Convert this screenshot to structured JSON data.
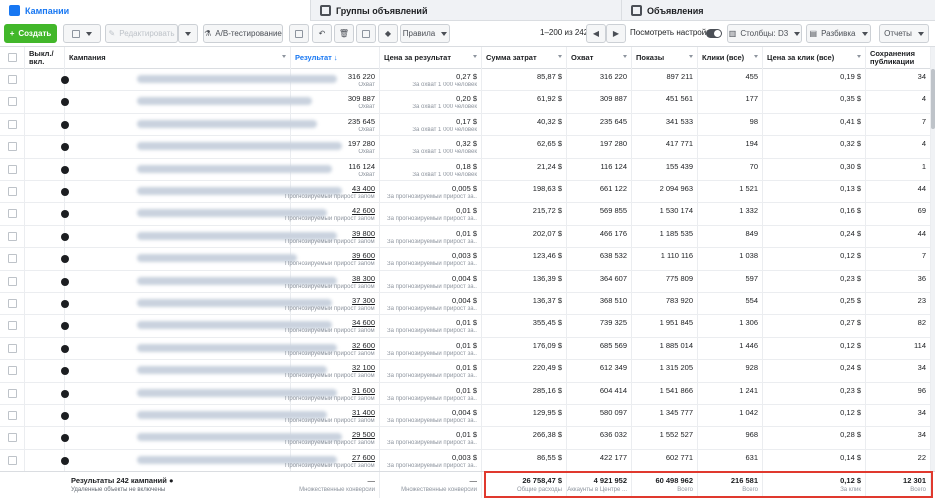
{
  "tabs": [
    {
      "label": "Кампании"
    },
    {
      "label": "Группы объявлений"
    },
    {
      "label": "Объявления"
    }
  ],
  "toolbar": {
    "create": "Создать",
    "edit": "Редактировать",
    "ab": "A/B-тестирование",
    "rules": "Правила",
    "range": "1–200 из 242",
    "view_settings": "Посмотреть настройки",
    "columns": "Столбцы: D3",
    "breakdown": "Разбивка",
    "reports": "Отчеты"
  },
  "columns": {
    "onoff": "Выкл./вкл.",
    "campaign": "Кампания",
    "result": "Результат",
    "cpr": "Цена за результат",
    "spend": "Сумма затрат",
    "reach": "Охват",
    "impr": "Показы",
    "clicks": "Клики (все)",
    "cpc": "Цена за клик (все)",
    "saves": "Сохранения публикации"
  },
  "rows": [
    {
      "result": "316 220",
      "result_sub": "Охват",
      "cpr": "0,27 $",
      "cpr_sub": "За охват 1 000 человек",
      "spend": "85,87 $",
      "reach": "316 220",
      "impr": "897 211",
      "clicks": "455",
      "cpc": "0,19 $",
      "saves": "34"
    },
    {
      "result": "309 887",
      "result_sub": "Охват",
      "cpr": "0,20 $",
      "cpr_sub": "За охват 1 000 человек",
      "spend": "61,92 $",
      "reach": "309 887",
      "impr": "451 561",
      "clicks": "177",
      "cpc": "0,35 $",
      "saves": "4"
    },
    {
      "result": "235 645",
      "result_sub": "Охват",
      "cpr": "0,17 $",
      "cpr_sub": "За охват 1 000 человек",
      "spend": "40,32 $",
      "reach": "235 645",
      "impr": "341 533",
      "clicks": "98",
      "cpc": "0,41 $",
      "saves": "7"
    },
    {
      "result": "197 280",
      "result_sub": "Охват",
      "cpr": "0,32 $",
      "cpr_sub": "За охват 1 000 человек",
      "spend": "62,65 $",
      "reach": "197 280",
      "impr": "417 771",
      "clicks": "194",
      "cpc": "0,32 $",
      "saves": "4"
    },
    {
      "result": "116 124",
      "result_sub": "Охват",
      "cpr": "0,18 $",
      "cpr_sub": "За охват 1 000 человек",
      "spend": "21,24 $",
      "reach": "116 124",
      "impr": "155 439",
      "clicks": "70",
      "cpc": "0,30 $",
      "saves": "1"
    },
    {
      "result": "43 400",
      "result_sub": "Прогнозируемый прирост запомин...",
      "cpr": "0,005 $",
      "cpr_sub": "За прогнозируемый прирост за...",
      "spend": "198,63 $",
      "reach": "661 122",
      "impr": "2 094 963",
      "clicks": "1 521",
      "cpc": "0,13 $",
      "saves": "44"
    },
    {
      "result": "42 600",
      "result_sub": "Прогнозируемый прирост запомин...",
      "cpr": "0,01 $",
      "cpr_sub": "За прогнозируемый прирост за...",
      "spend": "215,72 $",
      "reach": "569 855",
      "impr": "1 530 174",
      "clicks": "1 332",
      "cpc": "0,16 $",
      "saves": "69"
    },
    {
      "result": "39 800",
      "result_sub": "Прогнозируемый прирост запомин...",
      "cpr": "0,01 $",
      "cpr_sub": "За прогнозируемый прирост за...",
      "spend": "202,07 $",
      "reach": "466 176",
      "impr": "1 185 535",
      "clicks": "849",
      "cpc": "0,24 $",
      "saves": "44"
    },
    {
      "result": "39 600",
      "result_sub": "Прогнозируемый прирост запомин...",
      "cpr": "0,003 $",
      "cpr_sub": "За прогнозируемый прирост за...",
      "spend": "123,46 $",
      "reach": "638 532",
      "impr": "1 110 116",
      "clicks": "1 038",
      "cpc": "0,12 $",
      "saves": "7"
    },
    {
      "result": "38 300",
      "result_sub": "Прогнозируемый прирост запомин...",
      "cpr": "0,004 $",
      "cpr_sub": "За прогнозируемый прирост за...",
      "spend": "136,39 $",
      "reach": "364 607",
      "impr": "775 809",
      "clicks": "597",
      "cpc": "0,23 $",
      "saves": "36"
    },
    {
      "result": "37 300",
      "result_sub": "Прогнозируемый прирост запомин...",
      "cpr": "0,004 $",
      "cpr_sub": "За прогнозируемый прирост за...",
      "spend": "136,37 $",
      "reach": "368 510",
      "impr": "783 920",
      "clicks": "554",
      "cpc": "0,25 $",
      "saves": "23"
    },
    {
      "result": "34 600",
      "result_sub": "Прогнозируемый прирост запомин...",
      "cpr": "0,01 $",
      "cpr_sub": "За прогнозируемый прирост за...",
      "spend": "355,45 $",
      "reach": "739 325",
      "impr": "1 951 845",
      "clicks": "1 306",
      "cpc": "0,27 $",
      "saves": "82"
    },
    {
      "result": "32 600",
      "result_sub": "Прогнозируемый прирост запомин...",
      "cpr": "0,01 $",
      "cpr_sub": "За прогнозируемый прирост за...",
      "spend": "176,09 $",
      "reach": "685 569",
      "impr": "1 885 014",
      "clicks": "1 446",
      "cpc": "0,12 $",
      "saves": "114"
    },
    {
      "result": "32 100",
      "result_sub": "Прогнозируемый прирост запомин...",
      "cpr": "0,01 $",
      "cpr_sub": "За прогнозируемый прирост за...",
      "spend": "220,49 $",
      "reach": "612 349",
      "impr": "1 315 205",
      "clicks": "928",
      "cpc": "0,24 $",
      "saves": "34"
    },
    {
      "result": "31 600",
      "result_sub": "Прогнозируемый прирост запомин...",
      "cpr": "0,01 $",
      "cpr_sub": "За прогнозируемый прирост за...",
      "spend": "285,16 $",
      "reach": "604 414",
      "impr": "1 541 866",
      "clicks": "1 241",
      "cpc": "0,23 $",
      "saves": "96"
    },
    {
      "result": "31 400",
      "result_sub": "Прогнозируемый прирост запомин...",
      "cpr": "0,004 $",
      "cpr_sub": "За прогнозируемый прирост за...",
      "spend": "129,95 $",
      "reach": "580 097",
      "impr": "1 345 777",
      "clicks": "1 042",
      "cpc": "0,12 $",
      "saves": "34"
    },
    {
      "result": "29 500",
      "result_sub": "Прогнозируемый прирост запомин...",
      "cpr": "0,01 $",
      "cpr_sub": "За прогнозируемый прирост за...",
      "spend": "266,38 $",
      "reach": "636 032",
      "impr": "1 552 527",
      "clicks": "968",
      "cpc": "0,28 $",
      "saves": "34"
    },
    {
      "result": "27 600",
      "result_sub": "Прогнозируемый прирост запомин...",
      "cpr": "0,003 $",
      "cpr_sub": "За прогнозируемый прирост за...",
      "spend": "86,55 $",
      "reach": "422 177",
      "impr": "602 771",
      "clicks": "631",
      "cpc": "0,14 $",
      "saves": "22"
    }
  ],
  "footer": {
    "title": "Результаты 242 кампаний",
    "subtitle": "Удаленные объекты не включены",
    "result_dash": "—",
    "result_sub": "Множественные конверсии",
    "cpr_dash": "—",
    "cpr_sub": "Множественные конверсии",
    "spend": "26 758,47 $",
    "spend_sub": "Общие расходы",
    "reach": "4 921 952",
    "reach_sub": "Аккаунты в Центре ...",
    "impr": "60 498 962",
    "impr_sub": "Всего",
    "clicks": "216 581",
    "clicks_sub": "Всего",
    "cpc": "0,12 $",
    "cpc_sub": "За клик",
    "saves": "12 301",
    "saves_sub": "Всего"
  }
}
